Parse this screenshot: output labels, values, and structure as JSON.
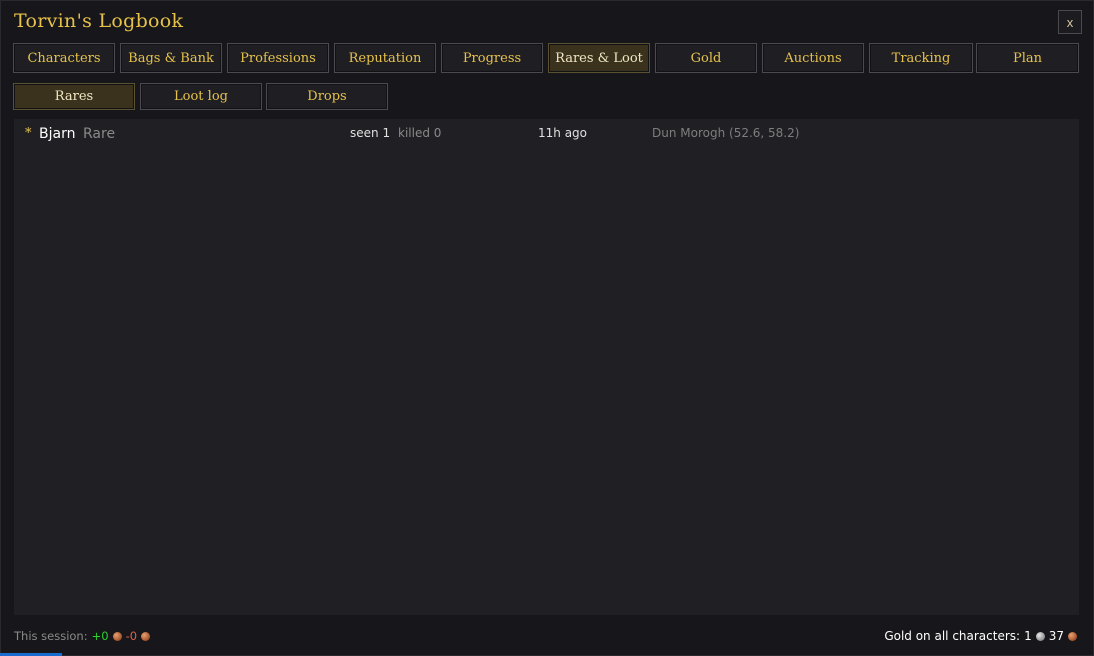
{
  "window": {
    "title": "Torvin's Logbook",
    "close_label": "x"
  },
  "tabs": [
    {
      "label": "Characters",
      "active": false
    },
    {
      "label": "Bags & Bank",
      "active": false
    },
    {
      "label": "Professions",
      "active": false
    },
    {
      "label": "Reputation",
      "active": false
    },
    {
      "label": "Progress",
      "active": false
    },
    {
      "label": "Rares & Loot",
      "active": true
    },
    {
      "label": "Gold",
      "active": false
    },
    {
      "label": "Auctions",
      "active": false
    },
    {
      "label": "Tracking",
      "active": false
    },
    {
      "label": "Plan",
      "active": false
    }
  ],
  "subtabs": [
    {
      "label": "Rares",
      "active": true
    },
    {
      "label": "Loot log",
      "active": false
    },
    {
      "label": "Drops",
      "active": false
    }
  ],
  "rares": [
    {
      "marker": "*",
      "name": "Bjarn",
      "type": "Rare",
      "seen": "seen 1",
      "killed": "killed 0",
      "last_seen": "11h ago",
      "location": "Dun Morogh (52.6, 58.2)"
    }
  ],
  "footer": {
    "session_label": "This session:",
    "session_gain": "+0",
    "session_loss": "-0",
    "gold_label": "Gold on all characters:",
    "gold_silver": "1",
    "gold_copper": "37"
  },
  "colors": {
    "accent_gold": "#e6c24c",
    "gain_green": "#2ad12a",
    "loss_red": "#e0604a"
  },
  "icons": {
    "copper": "copper-coin-icon",
    "silver": "silver-coin-icon"
  }
}
